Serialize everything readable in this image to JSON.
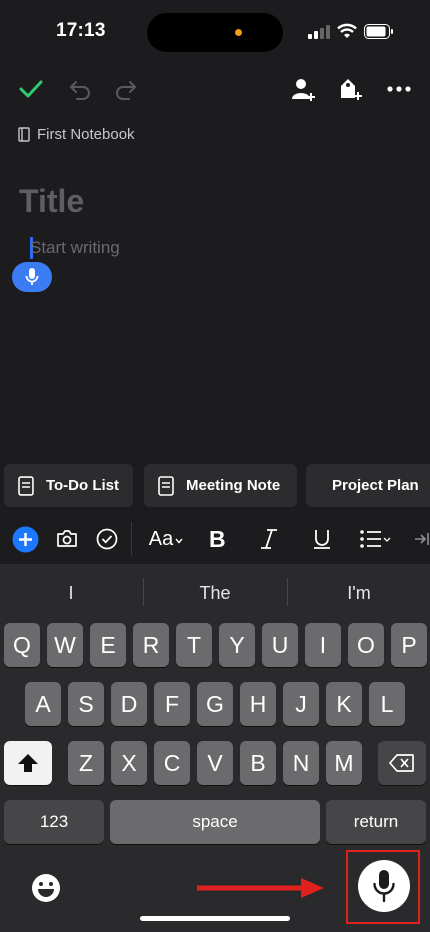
{
  "status_bar": {
    "time": "17:13"
  },
  "toolbar": {
    "done_icon": "checkmark-icon",
    "undo_icon": "undo-icon",
    "redo_icon": "redo-icon",
    "share_icon": "add-person-icon",
    "tag_icon": "add-tag-icon",
    "more_icon": "more-icon"
  },
  "note": {
    "notebook": "First Notebook",
    "title_placeholder": "Title",
    "body_placeholder": "Start writing"
  },
  "templates": [
    "To-Do List",
    "Meeting Note",
    "Project Plan"
  ],
  "format_bar": {
    "text_style_label": "Aa"
  },
  "keyboard": {
    "suggestions": [
      "I",
      "The",
      "I'm"
    ],
    "row1": [
      "Q",
      "W",
      "E",
      "R",
      "T",
      "Y",
      "U",
      "I",
      "O",
      "P"
    ],
    "row2": [
      "A",
      "S",
      "D",
      "F",
      "G",
      "H",
      "J",
      "K",
      "L"
    ],
    "row3": [
      "Z",
      "X",
      "C",
      "V",
      "B",
      "N",
      "M"
    ],
    "numbers_label": "123",
    "space_label": "space",
    "return_label": "return"
  },
  "colors": {
    "accent": "#3b7cf5",
    "check": "#2ecc71",
    "highlight": "#e0201c"
  }
}
